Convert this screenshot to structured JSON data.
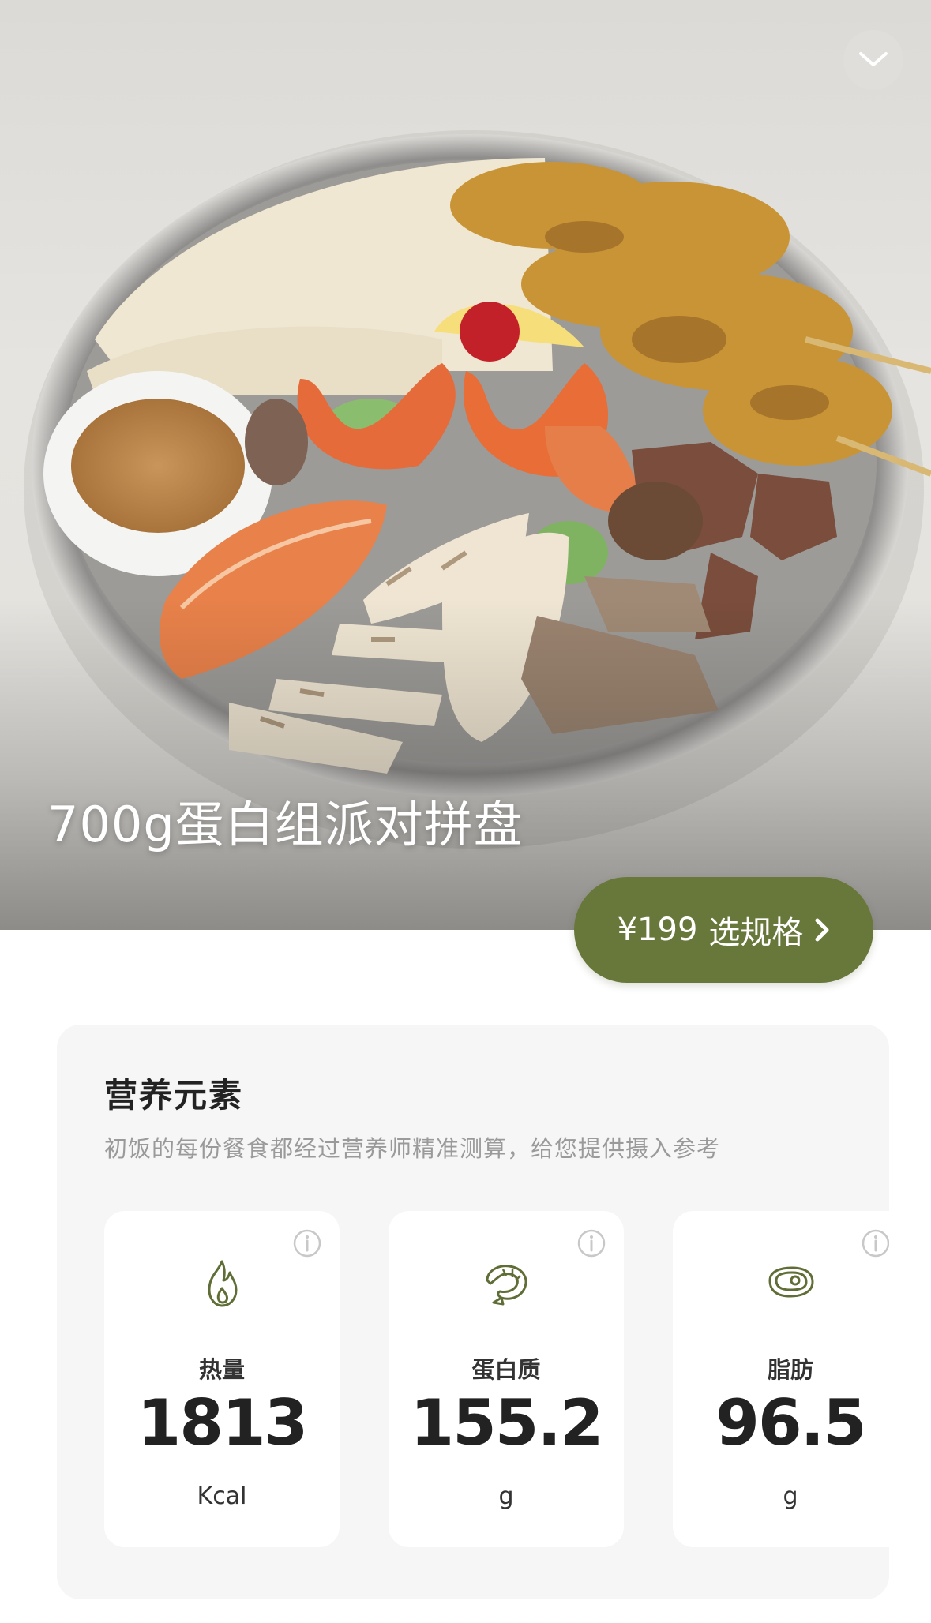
{
  "hero": {
    "title": "700g蛋白组派对拼盘",
    "collapse_icon": "chevron-down-icon"
  },
  "purchase": {
    "price": "¥199",
    "label": "选规格",
    "arrow_icon": "chevron-right-icon",
    "accent_color": "#68773a"
  },
  "nutrition": {
    "title": "营养元素",
    "description": "初饭的每份餐食都经过营养师精准测算，给您提供摄入参考",
    "metrics": [
      {
        "name": "热量",
        "value": "1813",
        "unit": "Kcal",
        "icon": "flame-icon"
      },
      {
        "name": "蛋白质",
        "value": "155.2",
        "unit": "g",
        "icon": "shrimp-icon"
      },
      {
        "name": "脂肪",
        "value": "96.5",
        "unit": "g",
        "icon": "meat-icon"
      }
    ]
  }
}
